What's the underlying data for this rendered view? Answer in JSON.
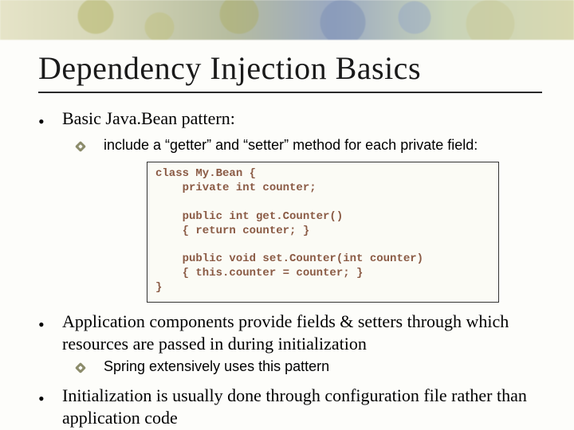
{
  "title": "Dependency Injection Basics",
  "bullets": {
    "b1a": "Basic Java.Bean pattern:",
    "b1a_sub": "include a “getter” and “setter” method for each private field:",
    "b1b": "Application components provide fields & setters through which resources are passed in during initialization",
    "b1b_sub": "Spring extensively uses this pattern",
    "b1c": "Initialization is usually done through configuration file rather than application code"
  },
  "code": "class My.Bean {\n    private int counter;\n\n    public int get.Counter()\n    { return counter; }\n\n    public void set.Counter(int counter)\n    { this.counter = counter; }\n}"
}
